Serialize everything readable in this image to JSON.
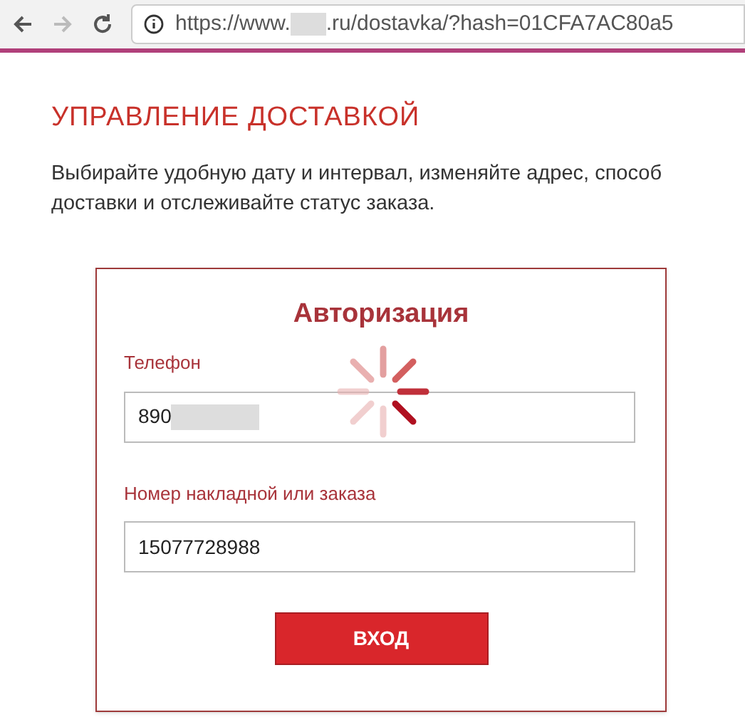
{
  "browser": {
    "url_prefix": "https://www.",
    "url_suffix": ".ru/dostavka/?hash=01CFA7AC80a5"
  },
  "page": {
    "heading": "УПРАВЛЕНИЕ ДОСТАВКОЙ",
    "intro": "Выбирайте удобную дату и интервал, изменяйте адрес, способ доставки и отслеживайте статус заказа."
  },
  "login": {
    "title": "Авторизация",
    "fields": [
      {
        "label": "Телефон",
        "value": "890",
        "redacted": true
      },
      {
        "label": "Номер накладной или заказа",
        "value": "15077728988",
        "redacted": false
      }
    ],
    "button": "ВХОД"
  }
}
